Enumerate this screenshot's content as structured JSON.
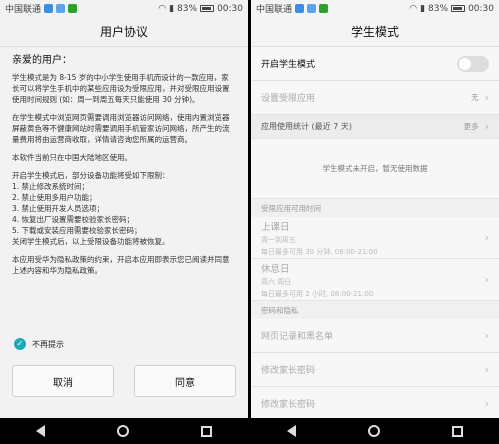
{
  "status": {
    "carrier": "中国联通",
    "battery": "83%",
    "time": "00:30"
  },
  "left": {
    "title": "用户协议",
    "greeting": "亲爱的用户：",
    "paragraphs": [
      "学生模式是为 8-15 岁的中小学生使用手机而设计的一款应用，家长可以将学生手机中的某些应用设为受限应用，并对受限应用设置使用时间规则 (如：周一到周五每天只能使用 30 分钟)。",
      "在学生模式中浏览网页需要调用浏览器访问网络，使用内置浏览器屏蔽黄色等不健康网站时需要调用手机管家访问网络，所产生的流量费用将由运营商收取，详情请咨询您所属的运营商。",
      "本软件当前只在中国大陆地区使用。",
      "开启学生模式后，部分设备功能将受如下限制：\n1. 禁止修改系统时间；\n2. 禁止使用多用户功能；\n3. 禁止使用开发人员选项；\n4. 恢复出厂设置需要校验家长密码；\n5. 下载或安装应用需要校验家长密码；\n关闭学生模式后，以上受限设备功能将被恢复。",
      "本应用受华为隐私政策的约束，开启本应用即表示您已阅读并同意上述内容和华为隐私政策。"
    ],
    "dont_show": "不再提示",
    "cancel": "取消",
    "agree": "同意"
  },
  "right": {
    "title": "学生模式",
    "enable_label": "开启学生模式",
    "set_restricted": "设置受限应用",
    "set_restricted_value": "无",
    "usage_stats": "应用使用统计 (最近 7 天)",
    "more": "更多",
    "not_enabled_msg": "学生模式未开启，暂无使用数据",
    "available_time_header": "受限应用可用时间",
    "workday": {
      "title": "上课日",
      "sub1": "周一到周五",
      "sub2": "每日最多可用 30 分钟, 08:00-21:00"
    },
    "restday": {
      "title": "休息日",
      "sub1": "周六 周日",
      "sub2": "每日最多可用 2 小时, 08:00-21:00"
    },
    "password_header": "密码和隐私",
    "web_history": "网页记录和黑名单",
    "change_password": "修改家长密码",
    "change_password2": "修改家长密码"
  }
}
